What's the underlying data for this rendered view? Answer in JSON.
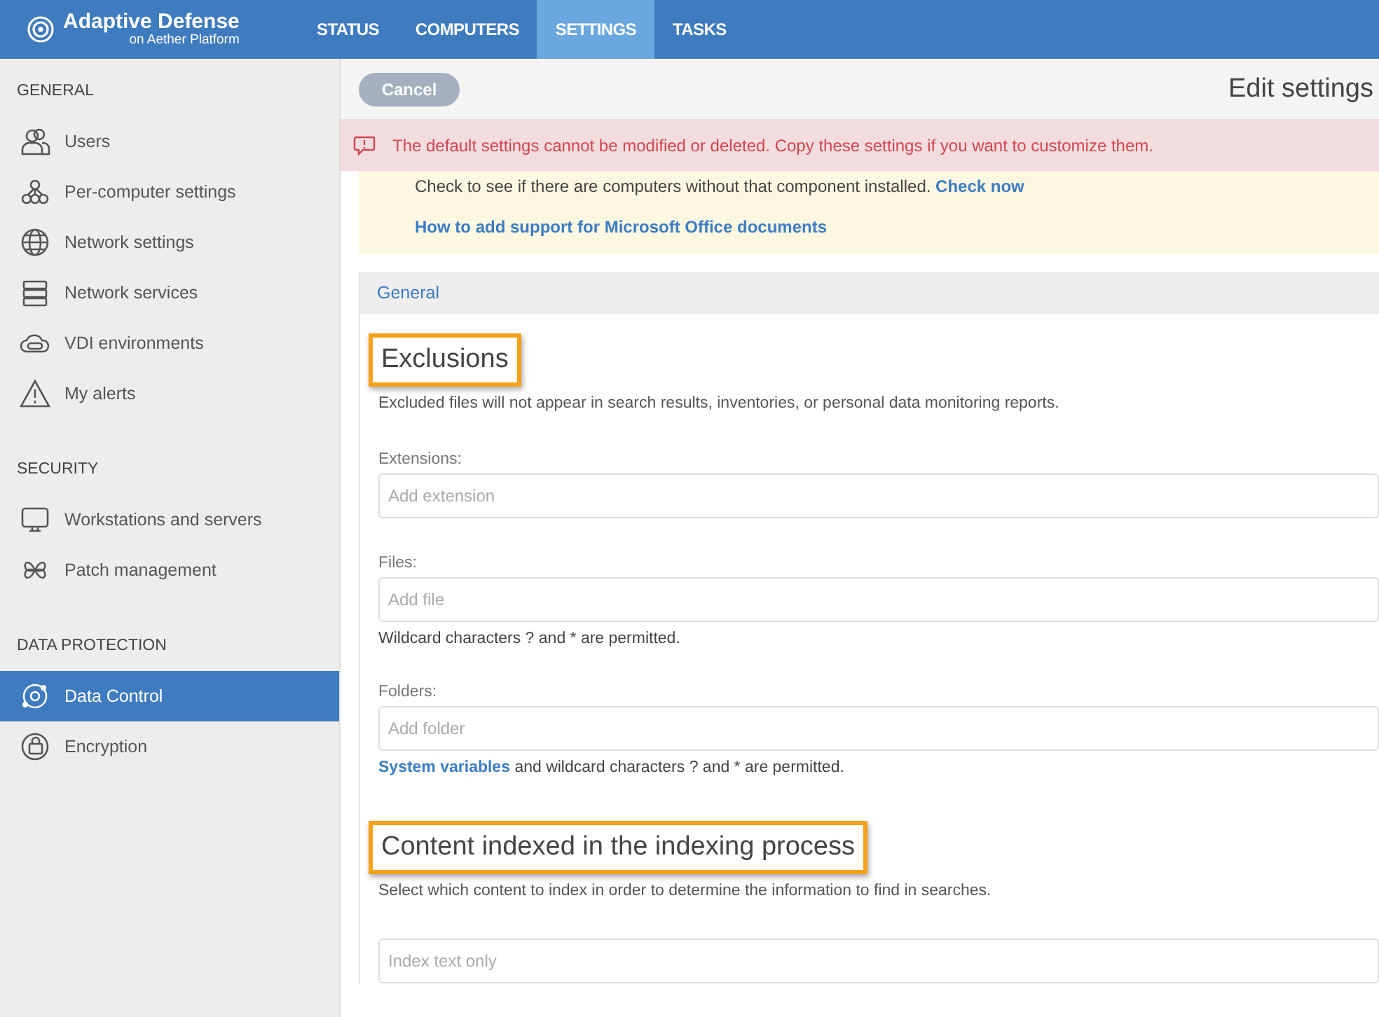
{
  "brand": {
    "name": "Adaptive Defense",
    "subtitle": "on Aether Platform"
  },
  "nav_tabs": [
    {
      "label": "STATUS",
      "selected": false
    },
    {
      "label": "COMPUTERS",
      "selected": false
    },
    {
      "label": "SETTINGS",
      "selected": true
    },
    {
      "label": "TASKS",
      "selected": false
    }
  ],
  "sidebar": {
    "sections": [
      {
        "title": "GENERAL",
        "items": [
          {
            "label": "Users",
            "selected": false
          },
          {
            "label": "Per-computer settings",
            "selected": false
          },
          {
            "label": "Network settings",
            "selected": false
          },
          {
            "label": "Network services",
            "selected": false
          },
          {
            "label": "VDI environments",
            "selected": false
          },
          {
            "label": "My alerts",
            "selected": false
          }
        ]
      },
      {
        "title": "SECURITY",
        "items": [
          {
            "label": "Workstations and servers",
            "selected": false
          },
          {
            "label": "Patch management",
            "selected": false
          }
        ]
      },
      {
        "title": "DATA PROTECTION",
        "items": [
          {
            "label": "Data Control",
            "selected": true
          },
          {
            "label": "Encryption",
            "selected": false
          }
        ]
      }
    ]
  },
  "toolbar": {
    "cancel_button": "Cancel",
    "title": "Edit settings"
  },
  "alert": {
    "message": "The default settings cannot be modified or deleted. Copy these settings if you want to customize them."
  },
  "notice": {
    "text": "Check to see if there are computers without that component installed.",
    "link": "Check now",
    "help_link": "How to add support for Microsoft Office documents"
  },
  "section_header": "General",
  "blocks": [
    {
      "heading": "Exclusions",
      "description": "Excluded files will not appear in search results, inventories, or personal data monitoring reports.",
      "fields": [
        {
          "label": "Extensions:",
          "placeholder": "Add extension"
        },
        {
          "label": "Files:",
          "placeholder": "Add file",
          "note": "Wildcard characters ? and * are permitted."
        },
        {
          "label": "Folders:",
          "placeholder": "Add folder",
          "note_link": "System variables",
          "note": "and wildcard characters ? and * are permitted."
        }
      ]
    },
    {
      "heading": "Content indexed in the indexing process",
      "description": "Select which content to index in order to determine the information to find in searches.",
      "fields": [
        {
          "placeholder": "Index text only"
        }
      ]
    }
  ]
}
